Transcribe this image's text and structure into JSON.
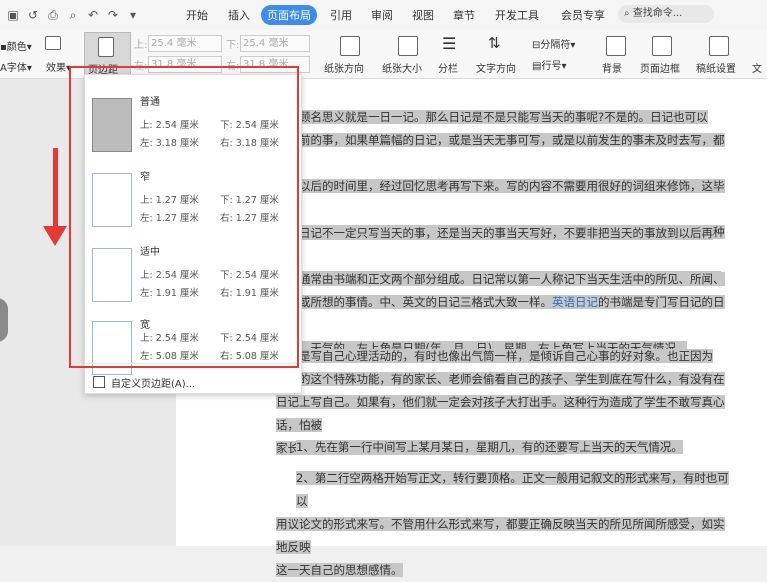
{
  "menubar": {
    "tabs": [
      "开始",
      "插入",
      "页面布局",
      "引用",
      "审阅",
      "视图",
      "章节",
      "开发工具",
      "会员专享"
    ],
    "active_tab": "页面布局",
    "search_placeholder": "查找命令..."
  },
  "ribbon": {
    "color_label": "颜色",
    "font_label": "字体",
    "effect_label": "效果",
    "margin_label": "页边距",
    "top_label": "上:",
    "top_value": "25.4 毫米",
    "bottom_label": "下:",
    "bottom_value": "25.4 毫米",
    "left_label": "左:",
    "left_value": "31.8 毫米",
    "right_label": "右:",
    "right_value": "31.8 毫米",
    "orientation": "纸张方向",
    "size": "纸张大小",
    "columns": "分栏",
    "text_direction": "文字方向",
    "separator": "分隔符",
    "line_number": "行号",
    "background": "背景",
    "page_border": "页面边框",
    "paper_setting": "稿纸设置",
    "text_more": "文"
  },
  "margins_menu": {
    "options": [
      {
        "name": "普通",
        "top": "上: 2.54 厘米",
        "bottom": "下: 2.54 厘米",
        "left": "左: 3.18 厘米",
        "right": "右: 3.18 厘米"
      },
      {
        "name": "窄",
        "top": "上: 1.27 厘米",
        "bottom": "下: 1.27 厘米",
        "left": "左: 1.27 厘米",
        "right": "右: 1.27 厘米"
      },
      {
        "name": "适中",
        "top": "上: 2.54 厘米",
        "bottom": "下: 2.54 厘米",
        "left": "左: 1.91 厘米",
        "right": "右: 1.91 厘米"
      },
      {
        "name": "宽",
        "top": "上: 2.54 厘米",
        "bottom": "下: 2.54 厘米",
        "left": "左: 5.08 厘米",
        "right": "右: 5.08 厘米"
      }
    ],
    "custom": "自定义页边距(A)..."
  },
  "document": {
    "paragraphs": [
      [
        "日记顾名思义就是一日一记。那么日记是不是只能写当天的事呢?不是的。日记也可以",
        "写以前的事，如果单篇幅的日记，或是当天无事可写，或是以前发生的事未及时去写，都可",
        "以在以后的时间里，经过回忆思考再写下来。写的内容不需要用很好的词组来修饰，这毕竟",
        "是一个人在一天内把所做的事情用文字来表达并保存下来。只要连贯，让人读起来有一种很",
        "真实的感觉就行了。随心所欲--想到什么就写什么，创造一个轻松的阅读环境便已足够。"
      ],
      [
        "虽然日记不一定只写当天的事，还是当天的事当天写好，不要非把当天的事放到以后再"
      ],
      [
        "日记通常由书端和正文两个部分组成。日记常以第一人称记下当天生活中的所见、所闻、",
        "所感或所想的事情。中、英文的日记三格式大致一样。英语日记的书端是专门写日记的日期、",
        "星期、天气的。左上角是日期(年、月、日)、星期。右上角写上当天的天气情况。"
      ],
      [
        "日记是写自己心理活动的，有时也像出气筒一样，是倾诉自己心事的好对象。也正因为",
        "日记的这个特殊功能，有的家长、老师会偷看自己的孩子、学生到底在写什么，有没有在",
        "日记上写自己。如果有，他们就一定会对孩子大打出手。这种行为造成了学生不敢写真心话，怕被",
        "家长、老师看见。希望老师家长给孩子一个开放的空间。"
      ],
      [
        "1、先在第一行中间写上某月某日，星期几，有的还要写上当天的天气情况。"
      ],
      [
        "2、第二行空两格开始写正文，转行要顶格。正文一般用记叙文的形式来写，有时也可以",
        "用议论文的形式来写。不管用什么形式来写，都要正确反映当天的所见所闻所感受，如实地反映",
        "这一天自己的思想感情。"
      ]
    ],
    "link_text": "英语日记"
  }
}
